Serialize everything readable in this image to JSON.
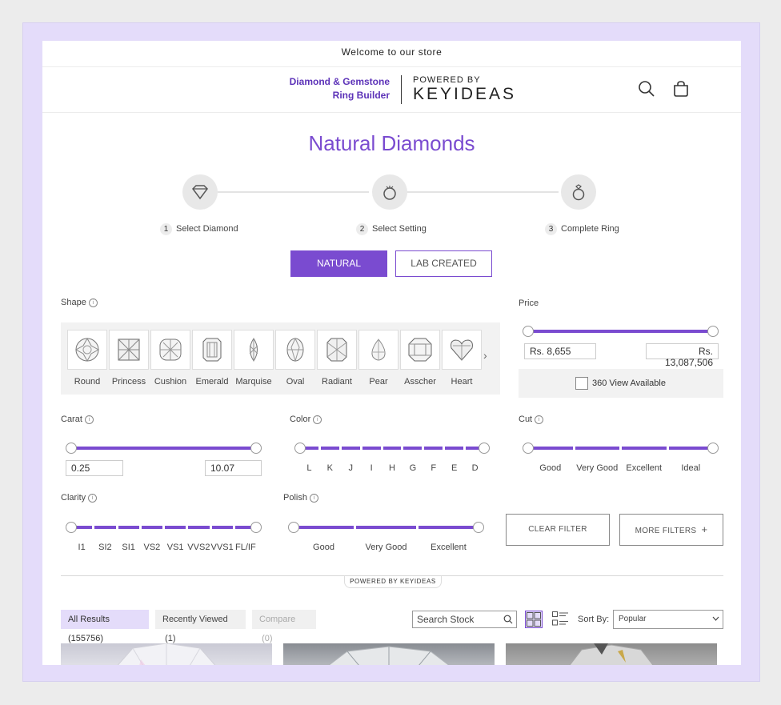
{
  "announcement": "Welcome to our store",
  "brand": {
    "line1": "Diamond & Gemstone",
    "line2": "Ring Builder",
    "powered_by": "POWERED BY",
    "keyideas": "KEYIDEAS"
  },
  "page_title": "Natural Diamonds",
  "steps": [
    {
      "num": "1",
      "label": "Select Diamond",
      "icon": "diamond-icon"
    },
    {
      "num": "2",
      "label": "Select Setting",
      "icon": "ring-setting-icon"
    },
    {
      "num": "3",
      "label": "Complete Ring",
      "icon": "ring-icon"
    }
  ],
  "type_toggle": {
    "natural": "NATURAL",
    "lab": "LAB CREATED",
    "active": "natural"
  },
  "filters": {
    "shape": {
      "label": "Shape",
      "items": [
        "Round",
        "Princess",
        "Cushion",
        "Emerald",
        "Marquise",
        "Oval",
        "Radiant",
        "Pear",
        "Asscher",
        "Heart"
      ]
    },
    "price": {
      "label": "Price",
      "min": "Rs. 8,655",
      "max": "Rs. 13,087,506"
    },
    "view360": {
      "label": "360 View Available",
      "checked": false
    },
    "carat": {
      "label": "Carat",
      "min": "0.25",
      "max": "10.07"
    },
    "color": {
      "label": "Color",
      "ticks": [
        "L",
        "K",
        "J",
        "I",
        "H",
        "G",
        "F",
        "E",
        "D"
      ]
    },
    "cut": {
      "label": "Cut",
      "ticks": [
        "Good",
        "Very Good",
        "Excellent",
        "Ideal"
      ]
    },
    "clarity": {
      "label": "Clarity",
      "ticks": [
        "I1",
        "SI2",
        "SI1",
        "VS2",
        "VS1",
        "VVS2",
        "VVS1",
        "FL/IF"
      ]
    },
    "polish": {
      "label": "Polish",
      "ticks": [
        "Good",
        "Very Good",
        "Excellent"
      ]
    }
  },
  "buttons": {
    "clear": "CLEAR FILTER",
    "more": "MORE FILTERS",
    "more_plus": "+"
  },
  "powered_badge": "POWERED BY KEYIDEAS",
  "results": {
    "tabs": [
      {
        "label": "All Results",
        "count": "(155756)"
      },
      {
        "label": "Recently Viewed",
        "count": "(1)"
      },
      {
        "label": "Compare",
        "count": "(0)"
      }
    ],
    "search_placeholder": "Search Stock",
    "sort_label": "Sort By:",
    "sort_value": "Popular"
  },
  "colors": {
    "accent": "#7a4bd0",
    "frame": "#e4dcfa"
  }
}
